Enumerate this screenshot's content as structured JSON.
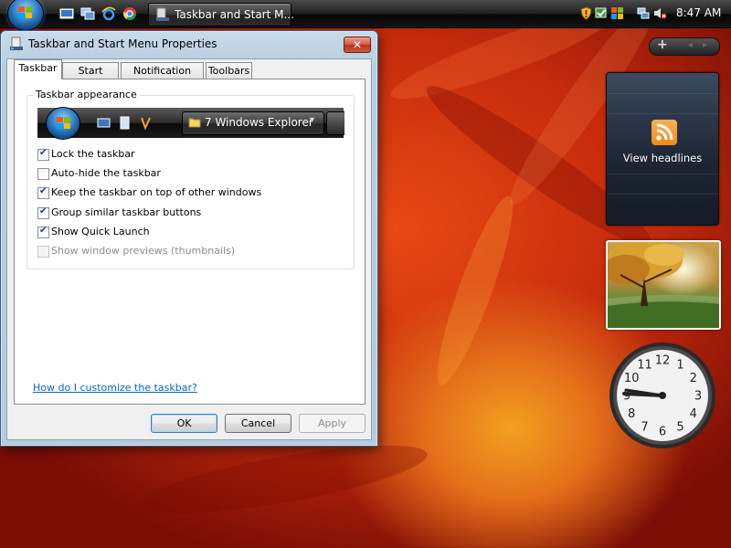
{
  "taskbar": {
    "start_label": "Start",
    "quick_launch": [
      "show-desktop-icon",
      "switch-windows-icon",
      "internet-explorer-icon",
      "chrome-icon"
    ],
    "task_button_label": "Taskbar and Start M...",
    "tray_icons": [
      "shield-icon",
      "security-icon",
      "windows-update-icon",
      "network-icon",
      "volume-muted-icon"
    ],
    "clock": "8:47 AM"
  },
  "dialog": {
    "title": "Taskbar and Start Menu Properties",
    "close_label": "✕",
    "tabs": [
      {
        "label": "Taskbar",
        "active": true
      },
      {
        "label": "Start Menu",
        "active": false
      },
      {
        "label": "Notification Area",
        "active": false
      },
      {
        "label": "Toolbars",
        "active": false
      }
    ],
    "group_label": "Taskbar appearance",
    "preview": {
      "button_label": "7 Windows Explorer"
    },
    "options": [
      {
        "label": "Lock the taskbar",
        "checked": true,
        "enabled": true
      },
      {
        "label": "Auto-hide the taskbar",
        "checked": false,
        "enabled": true
      },
      {
        "label": "Keep the taskbar on top of other windows",
        "checked": true,
        "enabled": true
      },
      {
        "label": "Group similar taskbar buttons",
        "checked": true,
        "enabled": true
      },
      {
        "label": "Show Quick Launch",
        "checked": true,
        "enabled": true
      },
      {
        "label": "Show window previews (thumbnails)",
        "checked": false,
        "enabled": false
      }
    ],
    "help_link": "How do I customize the taskbar?",
    "buttons": {
      "ok": "OK",
      "cancel": "Cancel",
      "apply": "Apply"
    }
  },
  "sidebar": {
    "add_label": "+",
    "feed_gadget_text": "View headlines",
    "clock_numbers": [
      "12",
      "1",
      "2",
      "3",
      "4",
      "5",
      "6",
      "7",
      "8",
      "9",
      "10",
      "11"
    ],
    "clock_time": "8:47"
  },
  "colors": {
    "accent_blue": "#2e7fc6",
    "link": "#0066cc",
    "close_red": "#c8402a",
    "rss_orange": "#f08a18"
  }
}
